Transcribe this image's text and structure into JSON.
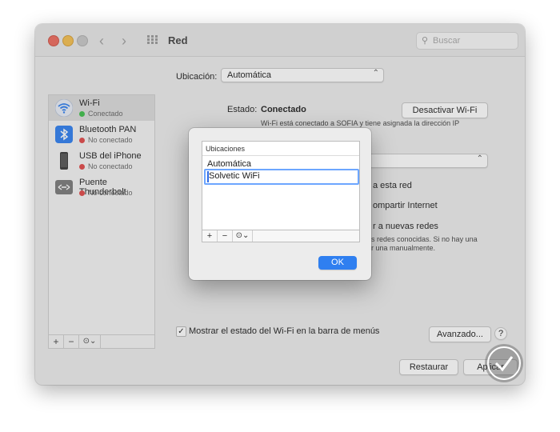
{
  "window": {
    "title": "Red",
    "search_placeholder": "Buscar",
    "location_label": "Ubicación:",
    "location_value": "Automática"
  },
  "sidebar": {
    "items": [
      {
        "name": "Wi-Fi",
        "status": "Conectado",
        "status_color": "#3fbf4a",
        "icon": "wifi-icon"
      },
      {
        "name": "Bluetooth PAN",
        "status": "No conectado",
        "status_color": "#e04848",
        "icon": "bluetooth-icon"
      },
      {
        "name": "USB del iPhone",
        "status": "No conectado",
        "status_color": "#e04848",
        "icon": "iphone-icon"
      },
      {
        "name": "Puente Thunderbolt",
        "status": "No conectado",
        "status_color": "#e04848",
        "icon": "thunderbolt-bridge-icon"
      }
    ],
    "tools": {
      "add": "+",
      "remove": "−",
      "actions": "⊙⌄"
    }
  },
  "detail": {
    "status_label": "Estado:",
    "status_value": "Conectado",
    "disable_wifi": "Desactivar Wi-Fi",
    "status_desc": "Wi-Fi está conectado a SOFIA y tiene asignada la dirección IP",
    "partial_1": "a esta red",
    "partial_2": "ompartir Internet",
    "partial_3": "r a nuevas redes",
    "partial_4": "s redes conocidas. Si no hay una",
    "partial_5": "r una manualmente.",
    "show_status_checkbox": "Mostrar el estado del Wi-Fi en la barra de menús",
    "advanced": "Avanzado...",
    "help": "?",
    "restore": "Restaurar",
    "apply": "Aplicar"
  },
  "dialog": {
    "header": "Ubicaciones",
    "items": [
      "Automática",
      "Solvetic WiFi"
    ],
    "tools": {
      "add": "+",
      "remove": "−",
      "actions": "⊙⌄"
    },
    "ok": "OK"
  },
  "colors": {
    "accent": "#2f7ff0",
    "focus_ring": "#6da6ff"
  }
}
